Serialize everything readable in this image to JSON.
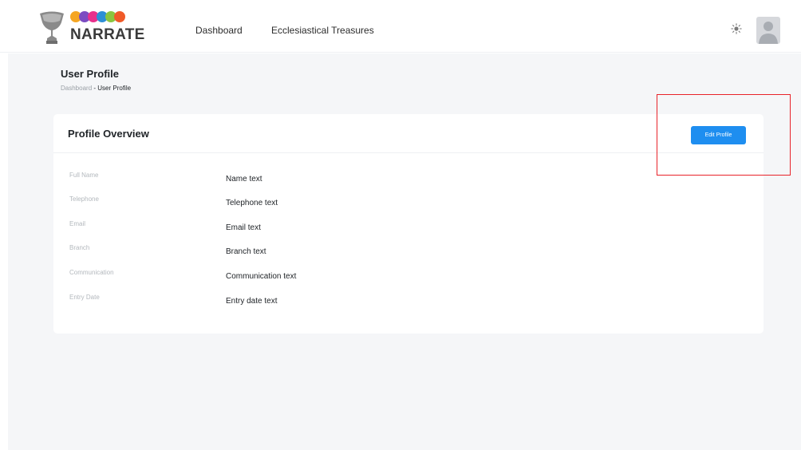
{
  "brand": {
    "name": "NARRATE",
    "dot_colors": [
      "#f5a623",
      "#7b4cc2",
      "#e8308c",
      "#2d8fd6",
      "#8bc53f",
      "#f05a28"
    ]
  },
  "nav": {
    "items": [
      {
        "label": "Dashboard"
      },
      {
        "label": "Ecclesiastical Treasures"
      }
    ]
  },
  "header": {
    "theme_icon": "sun-icon",
    "avatar_icon": "user-avatar-icon"
  },
  "page": {
    "title": "User Profile",
    "breadcrumb": {
      "parent": "Dashboard",
      "separator": " - ",
      "current": "User Profile"
    }
  },
  "card": {
    "title": "Profile Overview",
    "edit_button": "Edit Profile",
    "fields": [
      {
        "label": "Full Name",
        "value": "Name text"
      },
      {
        "label": "Telephone",
        "value": "Telephone text"
      },
      {
        "label": "Email",
        "value": "Email text"
      },
      {
        "label": "Branch",
        "value": "Branch text"
      },
      {
        "label": "Communication",
        "value": "Communication text"
      },
      {
        "label": "Entry Date",
        "value": "Entry date text"
      }
    ]
  },
  "colors": {
    "accent": "#1e8ef0",
    "highlight": "#e8232a",
    "content_bg": "#f5f6f8"
  }
}
